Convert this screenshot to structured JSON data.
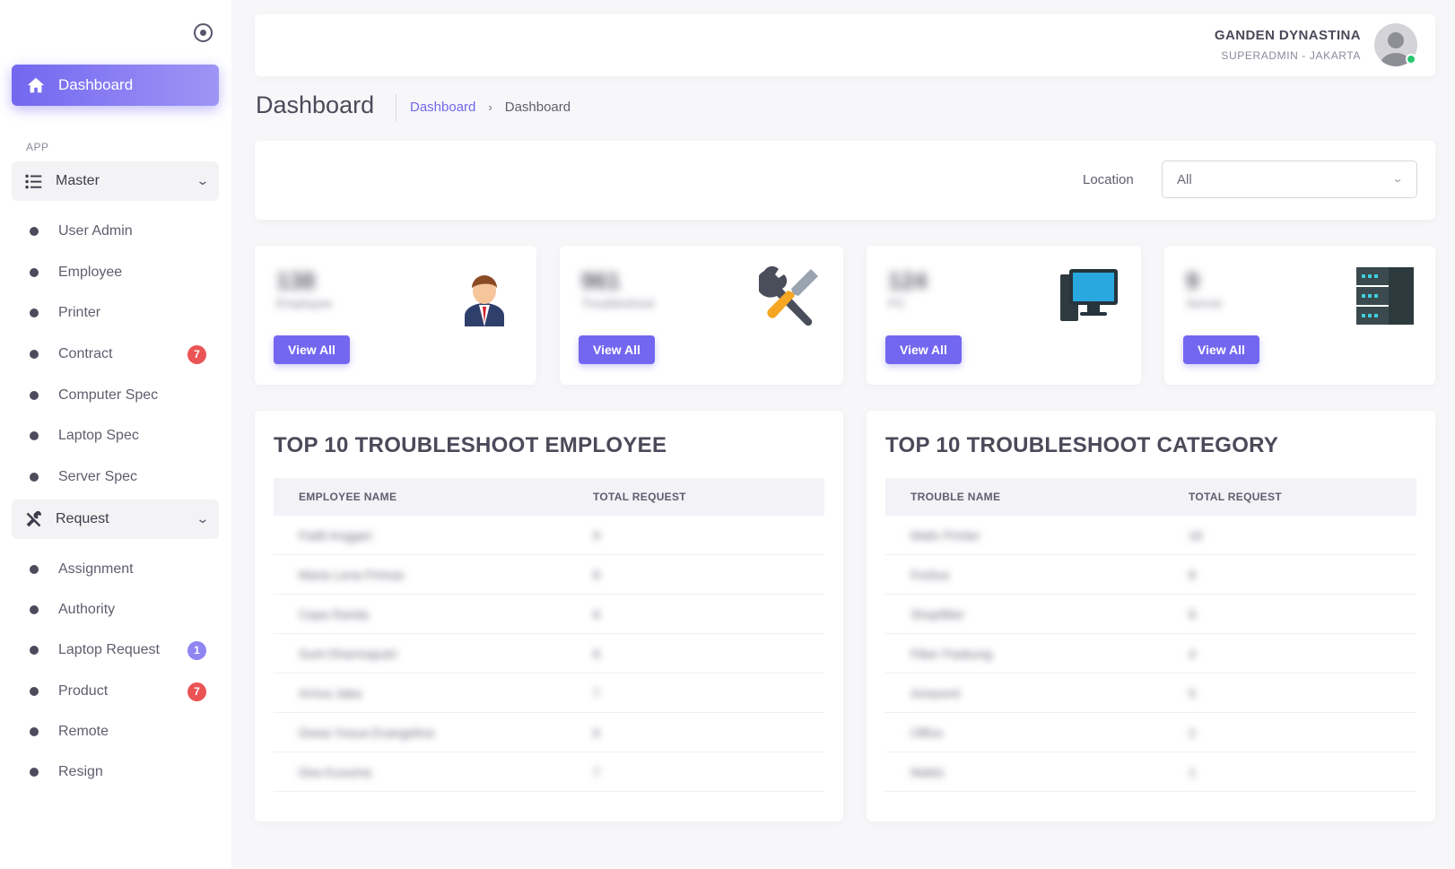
{
  "sidebar": {
    "dashboard_label": "Dashboard",
    "section_label": "APP",
    "master": {
      "label": "Master",
      "items": [
        {
          "label": "User Admin"
        },
        {
          "label": "Employee"
        },
        {
          "label": "Printer"
        },
        {
          "label": "Contract",
          "badge": "7",
          "badge_color": "#ea5455"
        },
        {
          "label": "Computer Spec"
        },
        {
          "label": "Laptop Spec"
        },
        {
          "label": "Server Spec"
        }
      ]
    },
    "request": {
      "label": "Request",
      "items": [
        {
          "label": "Assignment"
        },
        {
          "label": "Authority"
        },
        {
          "label": "Laptop Request",
          "badge": "1",
          "badge_color": "#7367f0"
        },
        {
          "label": "Product",
          "badge": "7",
          "badge_color": "#ea5455"
        },
        {
          "label": "Remote"
        },
        {
          "label": "Resign"
        }
      ]
    }
  },
  "header": {
    "user_name": "GANDEN DYNASTINA",
    "user_role": "SUPERADMIN - JAKARTA"
  },
  "page": {
    "title": "Dashboard",
    "breadcrumb": {
      "link": "Dashboard",
      "current": "Dashboard"
    }
  },
  "filter": {
    "location_label": "Location",
    "location_value": "All"
  },
  "stats": [
    {
      "value": "138",
      "label": "Employee",
      "button": "View All",
      "icon": "employee-icon"
    },
    {
      "value": "961",
      "label": "Troubleshoot",
      "button": "View All",
      "icon": "tools-icon"
    },
    {
      "value": "124",
      "label": "PC",
      "button": "View All",
      "icon": "computer-icon"
    },
    {
      "value": "9",
      "label": "Server",
      "button": "View All",
      "icon": "server-icon"
    }
  ],
  "employee_table": {
    "title": "TOP 10 TROUBLESHOOT EMPLOYEE",
    "columns": [
      "EMPLOYEE NAME",
      "TOTAL REQUEST"
    ],
    "rows": [
      [
        "Fadli Anggari",
        "9"
      ],
      [
        "Maria Lena Primas",
        "8"
      ],
      [
        "Cepa Ranita",
        "8"
      ],
      [
        "Surti Dharmaputri",
        "8"
      ],
      [
        "Arriva Jaka",
        "7"
      ],
      [
        "Dewa Yosua Evangelina",
        "6"
      ],
      [
        "Dea Kusuma",
        "7"
      ]
    ]
  },
  "category_table": {
    "title": "TOP 10 TROUBLESHOOT CATEGORY",
    "columns": [
      "TROUBLE NAME",
      "TOTAL REQUEST"
    ],
    "rows": [
      [
        "Mailx Printer",
        "16"
      ],
      [
        "Fortiva",
        "8"
      ],
      [
        "Shopfitter",
        "8"
      ],
      [
        "Fiber Pasbung",
        "4"
      ],
      [
        "Amazent",
        "5"
      ],
      [
        "Office",
        "2"
      ],
      [
        "Maklo",
        "1"
      ]
    ]
  }
}
